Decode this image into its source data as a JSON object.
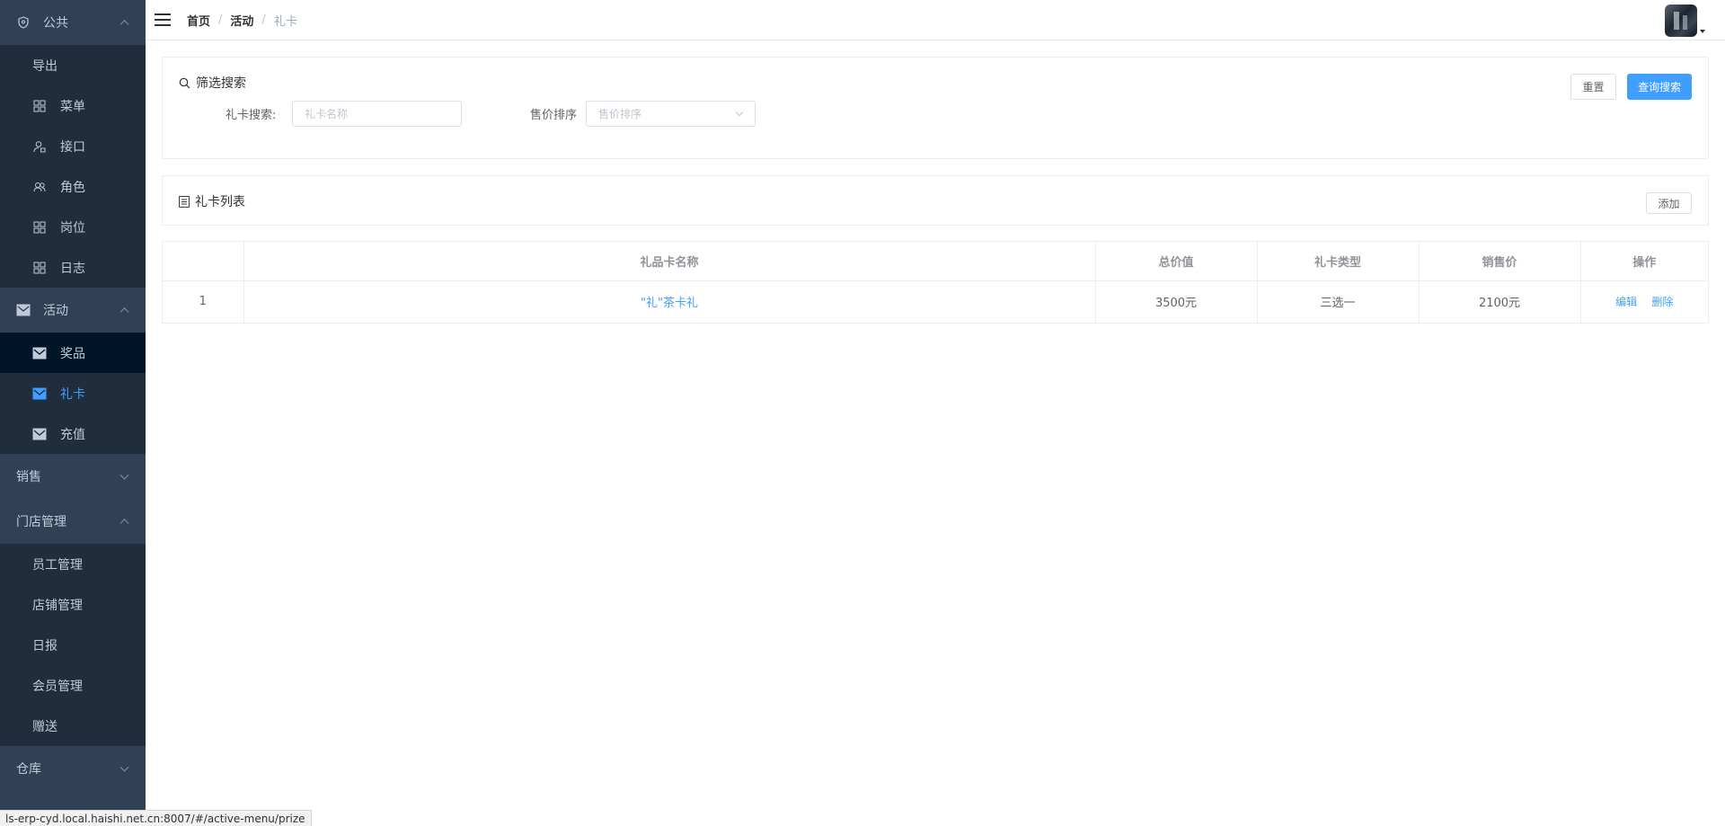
{
  "sidebar": {
    "group_public": "公共",
    "public_items": [
      "导出",
      "菜单",
      "接口",
      "角色",
      "岗位",
      "日志"
    ],
    "group_activity": "活动",
    "activity_items": [
      "奖品",
      "礼卡",
      "充值"
    ],
    "group_sales": "销售",
    "group_store": "门店管理",
    "store_items": [
      "员工管理",
      "店铺管理",
      "日报",
      "会员管理",
      "赠送"
    ],
    "group_warehouse": "仓库"
  },
  "breadcrumb": [
    "首页",
    "活动",
    "礼卡"
  ],
  "filter": {
    "title": "筛选搜索",
    "card_label": "礼卡搜索:",
    "card_placeholder": "礼卡名称",
    "sort_label": "售价排序",
    "sort_placeholder": "售价排序",
    "reset_label": "重置",
    "search_label": "查询搜索"
  },
  "list": {
    "title": "礼卡列表",
    "add_label": "添加"
  },
  "table": {
    "headers": [
      "",
      "礼品卡名称",
      "总价值",
      "礼卡类型",
      "销售价",
      "操作"
    ],
    "rows": [
      {
        "index": "1",
        "name": "\"礼\"茶卡礼",
        "total": "3500元",
        "type": "三选一",
        "price": "2100元",
        "edit": "编辑",
        "delete": "删除"
      }
    ]
  },
  "status_url": "ls-erp-cyd.local.haishi.net.cn:8007/#/active-menu/prize",
  "colors": {
    "sidebar_bg": "#304156",
    "submenu_bg": "#1f2d3d",
    "accent": "#409eff"
  }
}
